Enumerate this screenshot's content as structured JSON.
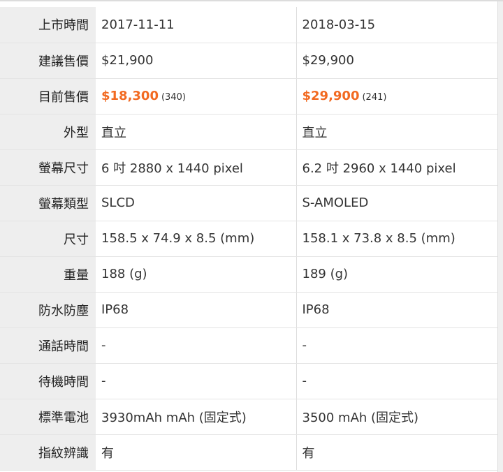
{
  "colors": {
    "price_accent": "#f26a21",
    "label_bg": "#eeeeee",
    "row_border": "#e4e4e4"
  },
  "rows": [
    {
      "label": "上市時間",
      "a": "2017-11-11",
      "b": "2018-03-15"
    },
    {
      "label": "建議售價",
      "a": "$21,900",
      "b": "$29,900"
    },
    {
      "label": "目前售價",
      "a_price": "$18,300",
      "a_count": "(340)",
      "b_price": "$29,900",
      "b_count": "(241)"
    },
    {
      "label": "外型",
      "a": "直立",
      "b": "直立"
    },
    {
      "label": "螢幕尺寸",
      "a": "6 吋 2880 x 1440 pixel",
      "b": "6.2 吋 2960 x 1440 pixel"
    },
    {
      "label": "螢幕類型",
      "a": "SLCD",
      "b": "S-AMOLED"
    },
    {
      "label": "尺寸",
      "a": "158.5 x 74.9 x 8.5 (mm)",
      "b": "158.1 x 73.8 x 8.5 (mm)"
    },
    {
      "label": "重量",
      "a": "188 (g)",
      "b": "189 (g)"
    },
    {
      "label": "防水防塵",
      "a": "IP68",
      "b": "IP68"
    },
    {
      "label": "通話時間",
      "a": "-",
      "b": "-"
    },
    {
      "label": "待機時間",
      "a": "-",
      "b": "-"
    },
    {
      "label": "標準電池",
      "a": "3930mAh mAh (固定式)",
      "b": "3500 mAh (固定式)"
    },
    {
      "label": "指紋辨識",
      "a": "有",
      "b": "有"
    }
  ]
}
